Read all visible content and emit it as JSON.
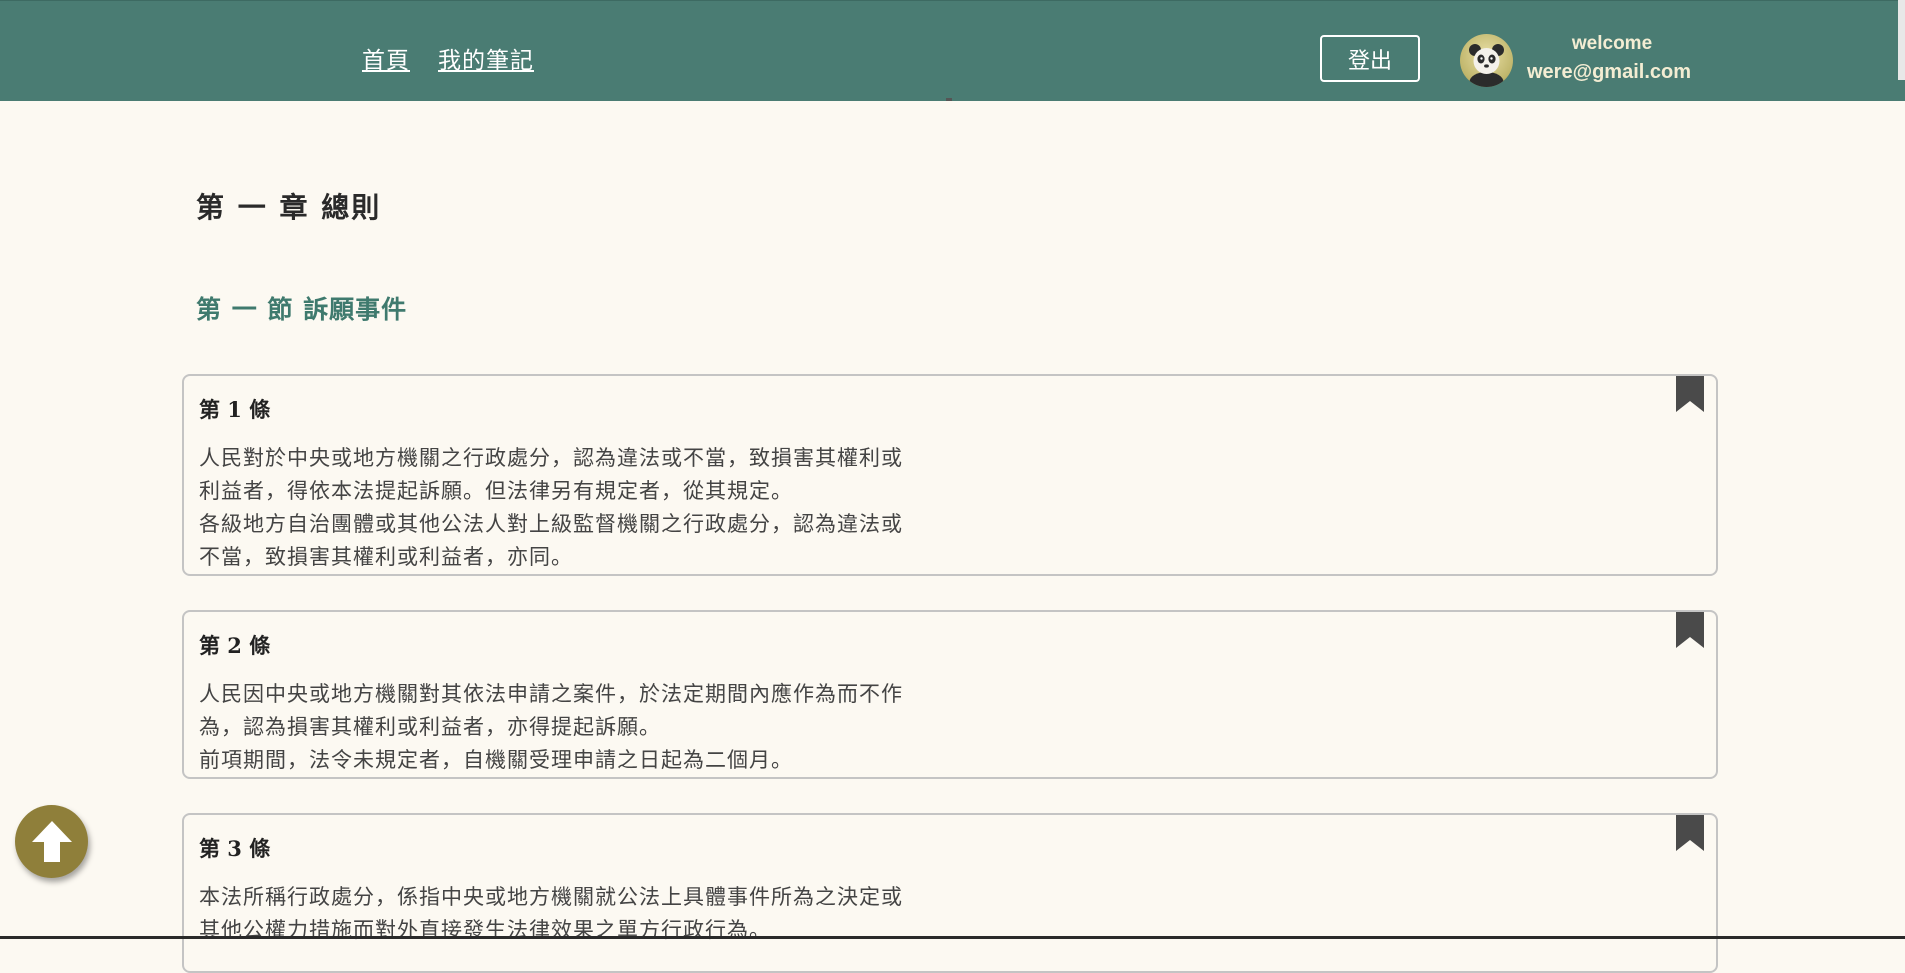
{
  "nav": {
    "links": [
      "首頁",
      "我的筆記"
    ],
    "logout_label": "登出"
  },
  "user": {
    "welcome": "welcome",
    "email": "were@gmail.com"
  },
  "content": {
    "chapter_title": "第 一 章 總則",
    "section_title": "第 一 節 訴願事件",
    "articles": [
      {
        "title": "第 1 條",
        "lines": [
          "人民對於中央或地方機關之行政處分，認為違法或不當，致損害其權利或",
          "利益者，得依本法提起訴願。但法律另有規定者，從其規定。",
          "各級地方自治團體或其他公法人對上級監督機關之行政處分，認為違法或",
          "不當，致損害其權利或利益者，亦同。"
        ]
      },
      {
        "title": "第 2 條",
        "lines": [
          "人民因中央或地方機關對其依法申請之案件，於法定期間內應作為而不作",
          "為，認為損害其權利或利益者，亦得提起訴願。",
          "前項期間，法令未規定者，自機關受理申請之日起為二個月。"
        ]
      },
      {
        "title": "第 3 條",
        "lines": [
          "本法所稱行政處分，係指中央或地方機關就公法上具體事件所為之決定或",
          "其他公權力措施而對外直接發生法律效果之單方行政行為。"
        ]
      }
    ]
  },
  "colors": {
    "navbar": "#4a7c73",
    "background": "#fcf9f2",
    "section_title": "#3f7a6e",
    "back_to_top": "#8f7f3a",
    "bookmark": "#4a4a4a"
  },
  "icons": {
    "avatar": "panda-avatar",
    "bookmark": "bookmark-icon",
    "back_to_top": "arrow-up-icon"
  }
}
